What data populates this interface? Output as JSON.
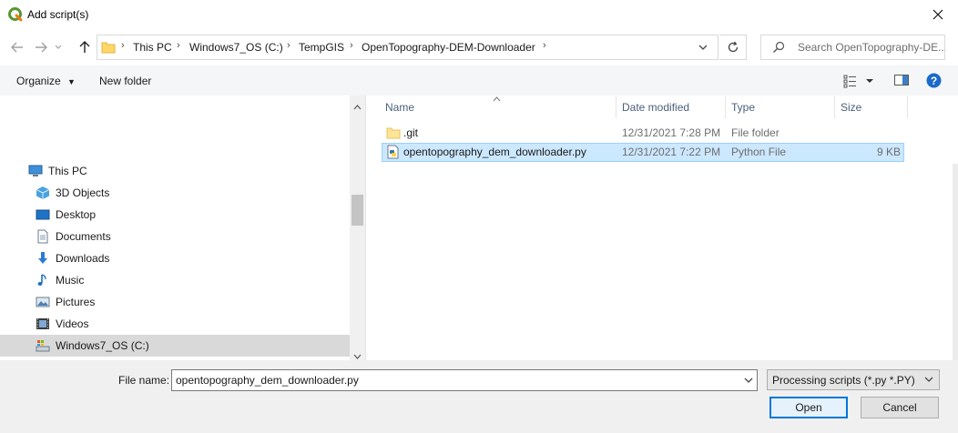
{
  "window": {
    "title": "Add script(s)"
  },
  "address": {
    "crumbs": [
      "This PC",
      "Windows7_OS (C:)",
      "TempGIS",
      "OpenTopography-DEM-Downloader"
    ]
  },
  "search": {
    "placeholder": "Search OpenTopography-DE..."
  },
  "toolbar": {
    "organize_label": "Organize",
    "new_folder_label": "New folder"
  },
  "nav": {
    "items": [
      {
        "label": "This PC",
        "icon": "computer-icon"
      },
      {
        "label": "3D Objects",
        "icon": "cube-icon"
      },
      {
        "label": "Desktop",
        "icon": "desktop-icon"
      },
      {
        "label": "Documents",
        "icon": "document-icon"
      },
      {
        "label": "Downloads",
        "icon": "download-icon"
      },
      {
        "label": "Music",
        "icon": "music-icon"
      },
      {
        "label": "Pictures",
        "icon": "picture-icon"
      },
      {
        "label": "Videos",
        "icon": "video-icon"
      },
      {
        "label": "Windows7_OS (C:)",
        "icon": "drive-icon"
      }
    ]
  },
  "filelist": {
    "columns": {
      "name": "Name",
      "date": "Date modified",
      "type": "Type",
      "size": "Size"
    },
    "rows": [
      {
        "name": ".git",
        "date": "12/31/2021 7:28 PM",
        "type": "File folder",
        "size": ""
      },
      {
        "name": "opentopography_dem_downloader.py",
        "date": "12/31/2021 7:22 PM",
        "type": "Python File",
        "size": "9 KB"
      }
    ]
  },
  "footer": {
    "filename_label": "File name:",
    "filename_value": "opentopography_dem_downloader.py",
    "filetype_value": "Processing scripts (*.py *.PY)",
    "open_label": "Open",
    "cancel_label": "Cancel"
  },
  "colors": {
    "accent": "#0078d7",
    "selection": "#cce8ff",
    "folder": "#ffd766"
  }
}
